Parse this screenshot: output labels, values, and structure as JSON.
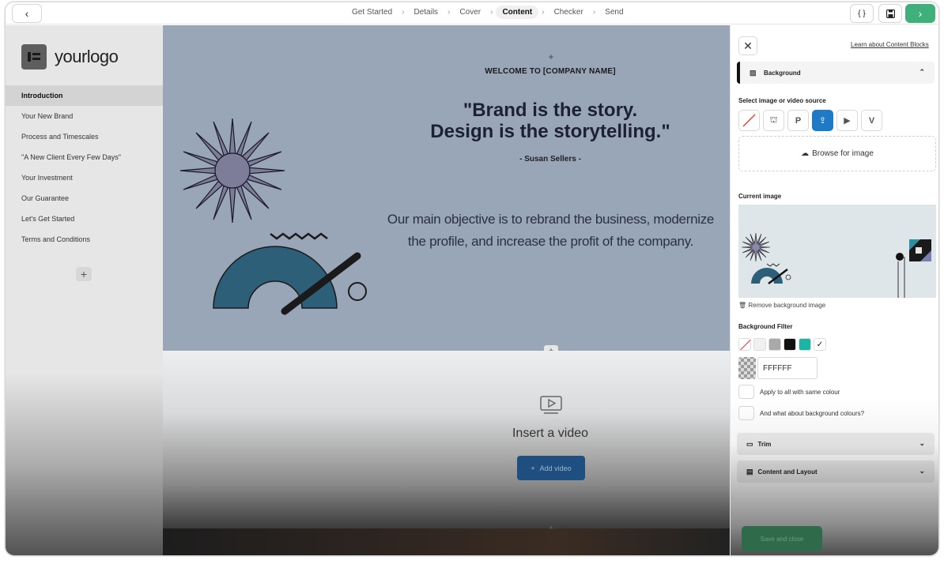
{
  "topbar": {
    "back_icon": "chevron-left-icon",
    "steps": [
      "Get Started",
      "Details",
      "Cover",
      "Content",
      "Checker",
      "Send"
    ],
    "active_step": "Content",
    "code_label": "{ }",
    "save_icon": "floppy-disk-icon",
    "next_icon": "chevron-right-icon",
    "accent": "#3fb07a"
  },
  "sidebar": {
    "logo_text": "yourlogo",
    "items": [
      {
        "label": "Introduction"
      },
      {
        "label": "Your New Brand"
      },
      {
        "label": "Process and Timescales"
      },
      {
        "label": "\"A New Client Every Few Days\""
      },
      {
        "label": "Your Investment"
      },
      {
        "label": "Our Guarantee"
      },
      {
        "label": "Let's Get Started"
      },
      {
        "label": "Terms and Conditions"
      }
    ],
    "add_label": "+"
  },
  "hero": {
    "welcome": "WELCOME TO [COMPANY NAME]",
    "quote_line1": "\"Brand is the story.",
    "quote_line2": "Design is the storytelling.\"",
    "author": "- Susan Sellers -",
    "objective_line1": "Our main objective is to rebrand the business, modernize",
    "objective_line2": "the profile, and increase the profit of the company.",
    "bg_color": "#99a6b8"
  },
  "video": {
    "title": "Insert a video",
    "button_label": "Add video"
  },
  "panel": {
    "learn_link": "Learn about Content Blocks",
    "background_label": "Background",
    "select_source_label": "Select image or video source",
    "sources": [
      "none-icon",
      "stock-icon",
      "pexels-icon",
      "upload-icon",
      "youtube-icon",
      "vimeo-icon"
    ],
    "active_source": "upload-icon",
    "browse_label": "Browse for image",
    "current_image_label": "Current image",
    "remove_label": "Remove background image",
    "filter_label": "Background Filter",
    "filter_colors": [
      "#ffffff",
      "#f0f0f0",
      "#a9a9a9",
      "#111111",
      "#19b5a5"
    ],
    "hex_value": "FFFFFF",
    "apply_all_label": "Apply to all with same colour",
    "bg_colours_label": "And what about background colours?",
    "trim_label": "Trim",
    "content_layout_label": "Content and Layout",
    "save_close_label": "Save and close"
  }
}
